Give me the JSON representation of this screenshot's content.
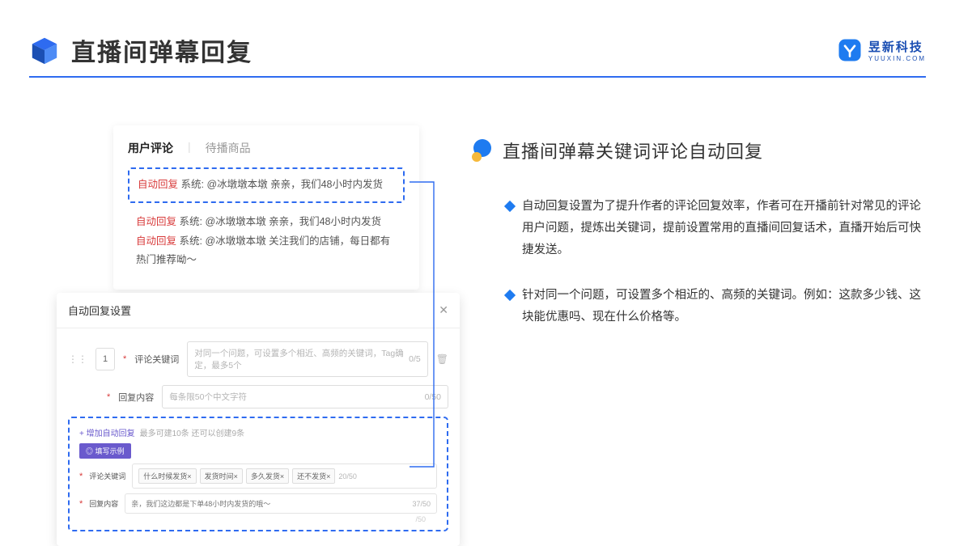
{
  "header": {
    "title": "直播间弹幕回复",
    "brand_name": "昱新科技",
    "brand_sub": "YUUXIN.COM"
  },
  "comments_panel": {
    "tab_active": "用户评论",
    "tab_other": "待播商品",
    "highlighted_tag": "自动回复",
    "highlighted_text": "系统: @冰墩墩本墩 亲亲，我们48小时内发货",
    "row2_tag": "自动回复",
    "row2_text": "系统: @冰墩墩本墩 亲亲，我们48小时内发货",
    "row3_tag": "自动回复",
    "row3_text": "系统: @冰墩墩本墩 关注我们的店铺，每日都有热门推荐呦～"
  },
  "settings_panel": {
    "title": "自动回复设置",
    "idx": "1",
    "kw_label": "评论关键词",
    "kw_placeholder": "对同一个问题，可设置多个相近、高频的关键词，Tag确定，最多5个",
    "kw_counter": "0/5",
    "rc_label": "回复内容",
    "rc_placeholder": "每条限50个中文字符",
    "rc_counter": "0/50",
    "add_link": "+ 增加自动回复",
    "add_hint": "最多可建10条 还可以创建9条",
    "badge": "◎ 填写示例",
    "ex_kw_label": "评论关键词",
    "ex_tags": [
      "什么时候发货×",
      "发货时间×",
      "多久发货×",
      "还不发货×"
    ],
    "ex_kw_counter": "20/50",
    "ex_rc_label": "回复内容",
    "ex_rc_value": "亲，我们这边都是下单48小时内发货的哦～",
    "ex_rc_counter": "37/50",
    "faint_counter": "/50"
  },
  "right": {
    "title": "直播间弹幕关键词评论自动回复",
    "bullet1": "自动回复设置为了提升作者的评论回复效率，作者可在开播前针对常见的评论用户问题，提炼出关键词，提前设置常用的直播间回复话术，直播开始后可快捷发送。",
    "bullet2": "针对同一个问题，可设置多个相近的、高频的关键词。例如：这款多少钱、这块能优惠吗、现在什么价格等。"
  }
}
